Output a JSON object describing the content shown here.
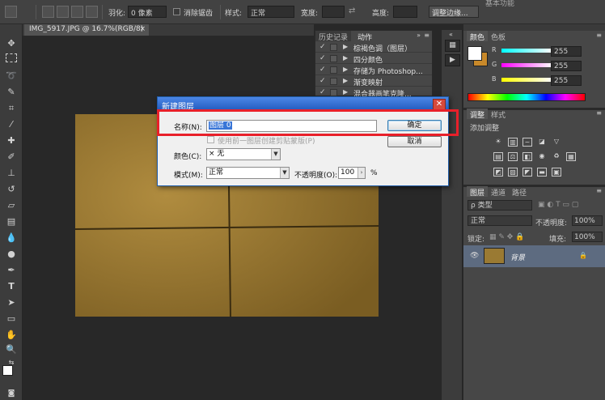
{
  "options_bar": {
    "feather_label": "羽化:",
    "feather_value": "0 像素",
    "antialias_label": "消除锯齿",
    "style_label": "样式:",
    "style_value": "正常",
    "width_label": "宽度:",
    "height_label": "高度:",
    "refine_button": "调整边缘..."
  },
  "top_right_text": "基本功能",
  "document": {
    "tab_title": "IMG_5917.JPG @ 16.7%(RGB/8)",
    "close_glyph": "×"
  },
  "actions_panel": {
    "tabs": [
      "历史记录",
      "动作"
    ],
    "active_tab": "动作",
    "rows": [
      {
        "check": "✓",
        "label": "棕褐色调（图层）"
      },
      {
        "check": "✓",
        "label": "四分颜色"
      },
      {
        "check": "✓",
        "label": "存储为 Photoshop..."
      },
      {
        "check": "✓",
        "label": "渐变映射"
      },
      {
        "check": "✓",
        "label": "混合器画笔克隆..."
      }
    ]
  },
  "color_panel": {
    "tabs": [
      "颜色",
      "色板"
    ],
    "channels": [
      {
        "name": "R",
        "value": "255"
      },
      {
        "name": "G",
        "value": "255"
      },
      {
        "name": "B",
        "value": "255"
      }
    ],
    "foreground": "#ffffff",
    "background": "#c8892a"
  },
  "adjust_panel": {
    "tabs": [
      "调整",
      "样式"
    ],
    "subtitle": "添加调整"
  },
  "layers_panel": {
    "tabs": [
      "图层",
      "通道",
      "路径"
    ],
    "kind_filter": "ρ 类型",
    "blend_mode": "正常",
    "opacity_label": "不透明度:",
    "opacity_value": "100%",
    "lock_label": "锁定:",
    "fill_label": "填充:",
    "fill_value": "100%",
    "layer_name": "背景"
  },
  "dialog": {
    "title": "新建图层",
    "name_label": "名称(N):",
    "name_value": "图层 0",
    "clip_checkbox_label": "使用前一图层创建剪贴蒙版(P)",
    "color_label": "颜色(C):",
    "color_value": "× 无",
    "mode_label": "模式(M):",
    "mode_value": "正常",
    "opacity_label": "不透明度(O):",
    "opacity_value": "100",
    "opacity_unit": "%",
    "ok_button": "确定",
    "cancel_button": "取消"
  },
  "colors": {
    "highlight": "#e8202a",
    "dialog_title": "#2f6ad0",
    "photo": "#9a7a33"
  }
}
